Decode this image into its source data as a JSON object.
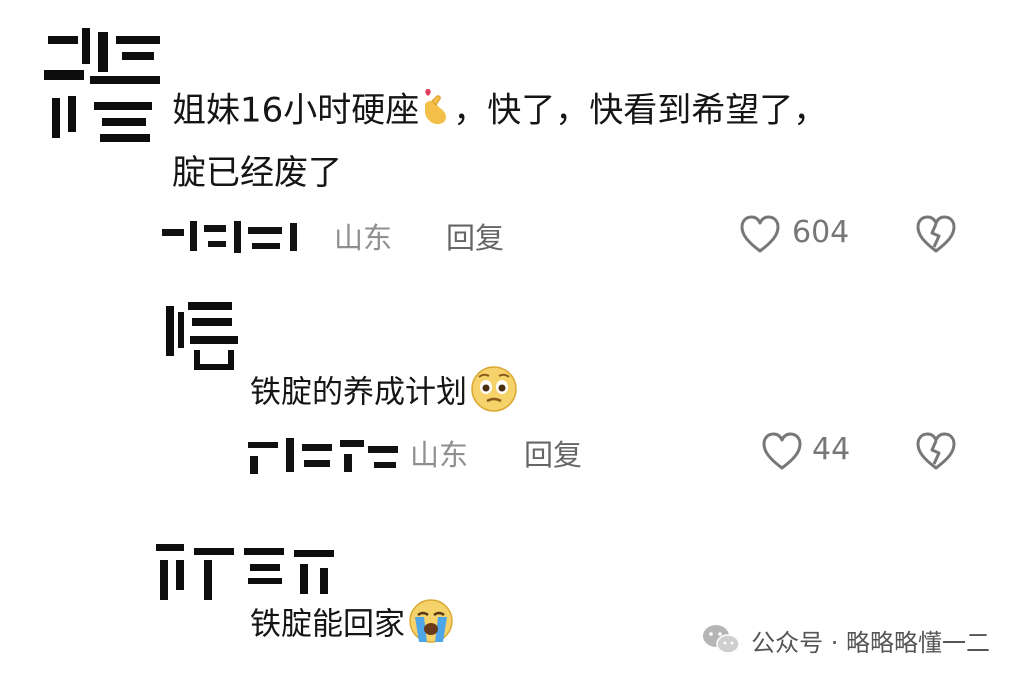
{
  "comments": [
    {
      "text_line1": "姐妹16小时硬座",
      "text_line1b": "，快了，快看到希望了，",
      "text_line2": "腚已经废了",
      "emoji": "heart-fingers-emoji",
      "location": "山东",
      "reply_label": "回复",
      "likes": "604"
    }
  ],
  "replies": [
    {
      "text": "铁腚的养成计划",
      "emoji": "pleading-face-emoji",
      "location": "山东",
      "reply_label": "回复",
      "likes": "44"
    },
    {
      "text": "铁腚能回家",
      "emoji": "crying-face-emoji"
    }
  ],
  "watermark": {
    "label": "公众号 · 略略略懂一二",
    "icon": "wechat-icon"
  },
  "colors": {
    "text": "#151515",
    "meta": "#8f8f8f",
    "icon": "#777777"
  }
}
